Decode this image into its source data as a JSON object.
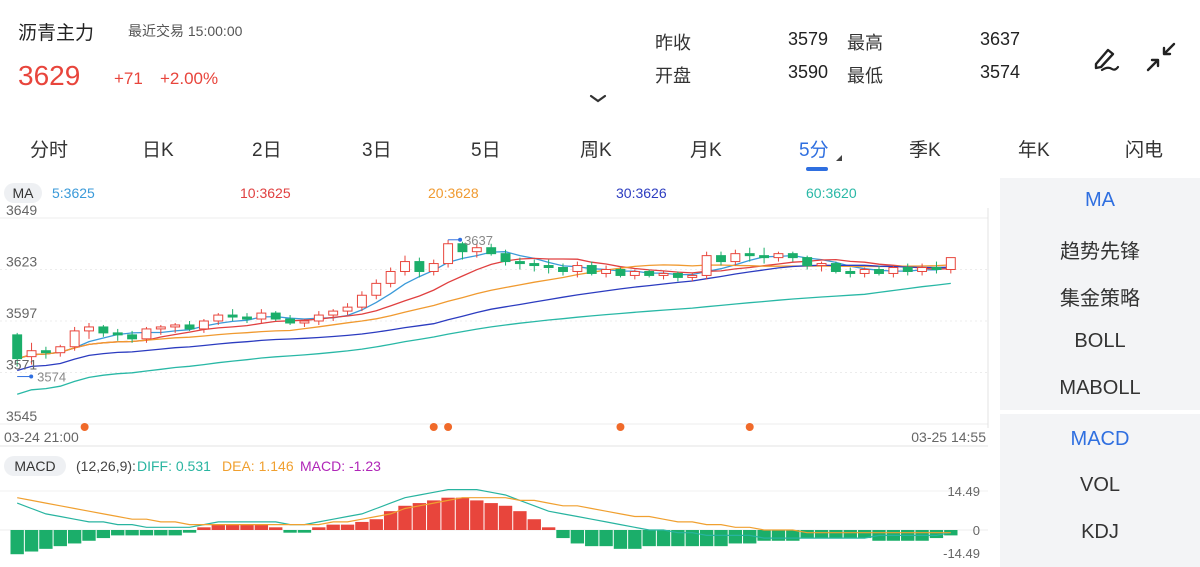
{
  "header": {
    "title": "沥青主力",
    "trade_label": "最近交易",
    "trade_time": "15:00:00",
    "price": "3629",
    "change": "+71",
    "change_pct": "+2.00%",
    "stats": {
      "prev_close_label": "昨收",
      "prev_close": "3579",
      "high_label": "最高",
      "high": "3637",
      "open_label": "开盘",
      "open": "3590",
      "low_label": "最低",
      "low": "3574"
    }
  },
  "tabs": [
    "分时",
    "日K",
    "2日",
    "3日",
    "5日",
    "周K",
    "月K",
    "5分",
    "季K",
    "年K",
    "闪电"
  ],
  "active_tab_index": 7,
  "main_panel": {
    "indicator_tag": "MA",
    "ma_legend": [
      {
        "text": "5:3625",
        "color": "#3a9ad9"
      },
      {
        "text": "10:3625",
        "color": "#e04040"
      },
      {
        "text": "20:3628",
        "color": "#f09a30"
      },
      {
        "text": "30:3626",
        "color": "#2c3cc0"
      },
      {
        "text": "60:3620",
        "color": "#29b8a6"
      }
    ],
    "y_ticks": [
      "3649",
      "3623",
      "3597",
      "3571",
      "3545"
    ],
    "high_marker": "3637",
    "low_marker": "3574",
    "x_start": "03-24 21:00",
    "x_end": "03-25 14:55"
  },
  "macd_panel": {
    "tag": "MACD",
    "params": "(12,26,9):",
    "diff": "DIFF: 0.531",
    "dea": "DEA: 1.146",
    "macd": "MACD: -1.23",
    "y_top": "14.49",
    "y_mid": "0",
    "y_bottom": "-14.49"
  },
  "side_indicators_top": [
    "MA",
    "趋势先锋",
    "集金策略",
    "BOLL",
    "MABOLL"
  ],
  "side_indicators_bottom": [
    "MACD",
    "VOL",
    "KDJ"
  ],
  "colors": {
    "up": "#e8453c",
    "down": "#1bae6a",
    "accent": "#2f6fe0",
    "diff": "#28b4a0",
    "dea": "#f0a030",
    "macd": "#b026b8"
  },
  "chart_data": {
    "type": "candlestick",
    "ylim": [
      3545,
      3649
    ],
    "candles": [
      [
        3590,
        3591,
        3574,
        3578
      ],
      [
        3579,
        3586,
        3575,
        3582
      ],
      [
        3582,
        3584,
        3578,
        3581
      ],
      [
        3581,
        3585,
        3579,
        3584
      ],
      [
        3584,
        3594,
        3582,
        3592
      ],
      [
        3592,
        3596,
        3588,
        3594
      ],
      [
        3594,
        3595,
        3589,
        3591
      ],
      [
        3591,
        3593,
        3587,
        3590
      ],
      [
        3590,
        3592,
        3586,
        3588
      ],
      [
        3588,
        3594,
        3586,
        3593
      ],
      [
        3593,
        3595,
        3590,
        3594
      ],
      [
        3594,
        3596,
        3591,
        3595
      ],
      [
        3595,
        3597,
        3592,
        3593
      ],
      [
        3593,
        3598,
        3591,
        3597
      ],
      [
        3597,
        3601,
        3595,
        3600
      ],
      [
        3600,
        3603,
        3597,
        3599
      ],
      [
        3599,
        3601,
        3596,
        3598
      ],
      [
        3598,
        3603,
        3596,
        3601
      ],
      [
        3601,
        3602,
        3597,
        3598
      ],
      [
        3598,
        3600,
        3595,
        3596
      ],
      [
        3596,
        3598,
        3594,
        3597
      ],
      [
        3597,
        3602,
        3595,
        3600
      ],
      [
        3600,
        3603,
        3597,
        3602
      ],
      [
        3602,
        3606,
        3600,
        3604
      ],
      [
        3604,
        3612,
        3602,
        3610
      ],
      [
        3610,
        3618,
        3608,
        3616
      ],
      [
        3616,
        3624,
        3614,
        3622
      ],
      [
        3622,
        3630,
        3620,
        3627
      ],
      [
        3627,
        3629,
        3619,
        3622
      ],
      [
        3622,
        3628,
        3620,
        3626
      ],
      [
        3626,
        3638,
        3624,
        3636
      ],
      [
        3636,
        3637,
        3628,
        3632
      ],
      [
        3632,
        3636,
        3629,
        3634
      ],
      [
        3634,
        3636,
        3630,
        3631
      ],
      [
        3631,
        3633,
        3625,
        3627
      ],
      [
        3627,
        3629,
        3623,
        3626
      ],
      [
        3626,
        3628,
        3622,
        3625
      ],
      [
        3625,
        3628,
        3621,
        3624
      ],
      [
        3624,
        3626,
        3620,
        3622
      ],
      [
        3622,
        3627,
        3619,
        3625
      ],
      [
        3625,
        3627,
        3620,
        3621
      ],
      [
        3621,
        3625,
        3619,
        3623
      ],
      [
        3623,
        3624,
        3619,
        3620
      ],
      [
        3620,
        3623,
        3618,
        3622
      ],
      [
        3622,
        3623,
        3619,
        3620
      ],
      [
        3620,
        3622,
        3618,
        3621
      ],
      [
        3621,
        3622,
        3617,
        3619
      ],
      [
        3619,
        3621,
        3617,
        3620
      ],
      [
        3620,
        3632,
        3618,
        3630
      ],
      [
        3630,
        3632,
        3625,
        3627
      ],
      [
        3627,
        3633,
        3625,
        3631
      ],
      [
        3631,
        3634,
        3627,
        3630
      ],
      [
        3630,
        3634,
        3626,
        3629
      ],
      [
        3629,
        3632,
        3627,
        3631
      ],
      [
        3631,
        3632,
        3627,
        3629
      ],
      [
        3629,
        3630,
        3623,
        3625
      ],
      [
        3625,
        3627,
        3622,
        3626
      ],
      [
        3626,
        3627,
        3621,
        3622
      ],
      [
        3622,
        3624,
        3619,
        3621
      ],
      [
        3621,
        3624,
        3619,
        3623
      ],
      [
        3623,
        3625,
        3620,
        3621
      ],
      [
        3621,
        3625,
        3619,
        3624
      ],
      [
        3624,
        3626,
        3620,
        3622
      ],
      [
        3622,
        3626,
        3620,
        3624
      ],
      [
        3624,
        3627,
        3621,
        3623
      ],
      [
        3623,
        3629,
        3621,
        3629
      ]
    ],
    "macd_hist": [
      -9,
      -8,
      -7,
      -6,
      -5,
      -4,
      -3,
      -2,
      -2,
      -2,
      -2,
      -2,
      -1,
      1,
      2,
      2,
      2,
      2,
      1,
      -1,
      -1,
      1,
      2,
      2,
      3,
      4,
      7,
      9,
      10,
      11,
      12,
      12,
      11,
      10,
      9,
      7,
      4,
      1,
      -3,
      -5,
      -6,
      -6,
      -7,
      -7,
      -6,
      -6,
      -6,
      -6,
      -6,
      -6,
      -5,
      -5,
      -4,
      -4,
      -4,
      -3,
      -3,
      -3,
      -3,
      -3,
      -4,
      -4,
      -4,
      -4,
      -3,
      -2
    ],
    "diff": [
      10,
      8,
      6,
      5,
      4,
      3,
      3,
      2,
      2,
      1,
      1,
      1,
      1,
      2,
      3,
      3,
      3,
      3,
      3,
      2,
      2,
      3,
      4,
      5,
      6,
      8,
      10,
      12,
      13,
      14,
      15,
      15,
      15,
      14,
      13,
      11,
      9,
      7,
      6,
      5,
      4,
      3,
      2,
      1,
      0,
      0,
      -1,
      -1,
      -2,
      -2,
      -2,
      -2,
      -3,
      -3,
      -3,
      -3,
      -3,
      -3,
      -3,
      -3,
      -2,
      -2,
      -2,
      -2,
      -2,
      -1
    ],
    "dea": [
      12,
      11,
      10,
      9,
      8,
      7,
      6,
      5,
      4,
      4,
      3,
      3,
      2,
      2,
      2,
      2,
      2,
      2,
      2,
      2,
      2,
      2,
      3,
      3,
      4,
      5,
      6,
      8,
      9,
      10,
      11,
      12,
      12,
      12,
      12,
      11,
      11,
      10,
      9,
      9,
      8,
      7,
      6,
      5,
      5,
      4,
      3,
      3,
      2,
      2,
      1,
      1,
      0,
      0,
      0,
      -1,
      -1,
      -1,
      -1,
      -1,
      -1,
      -1,
      -1,
      -1,
      -1,
      -1
    ]
  }
}
